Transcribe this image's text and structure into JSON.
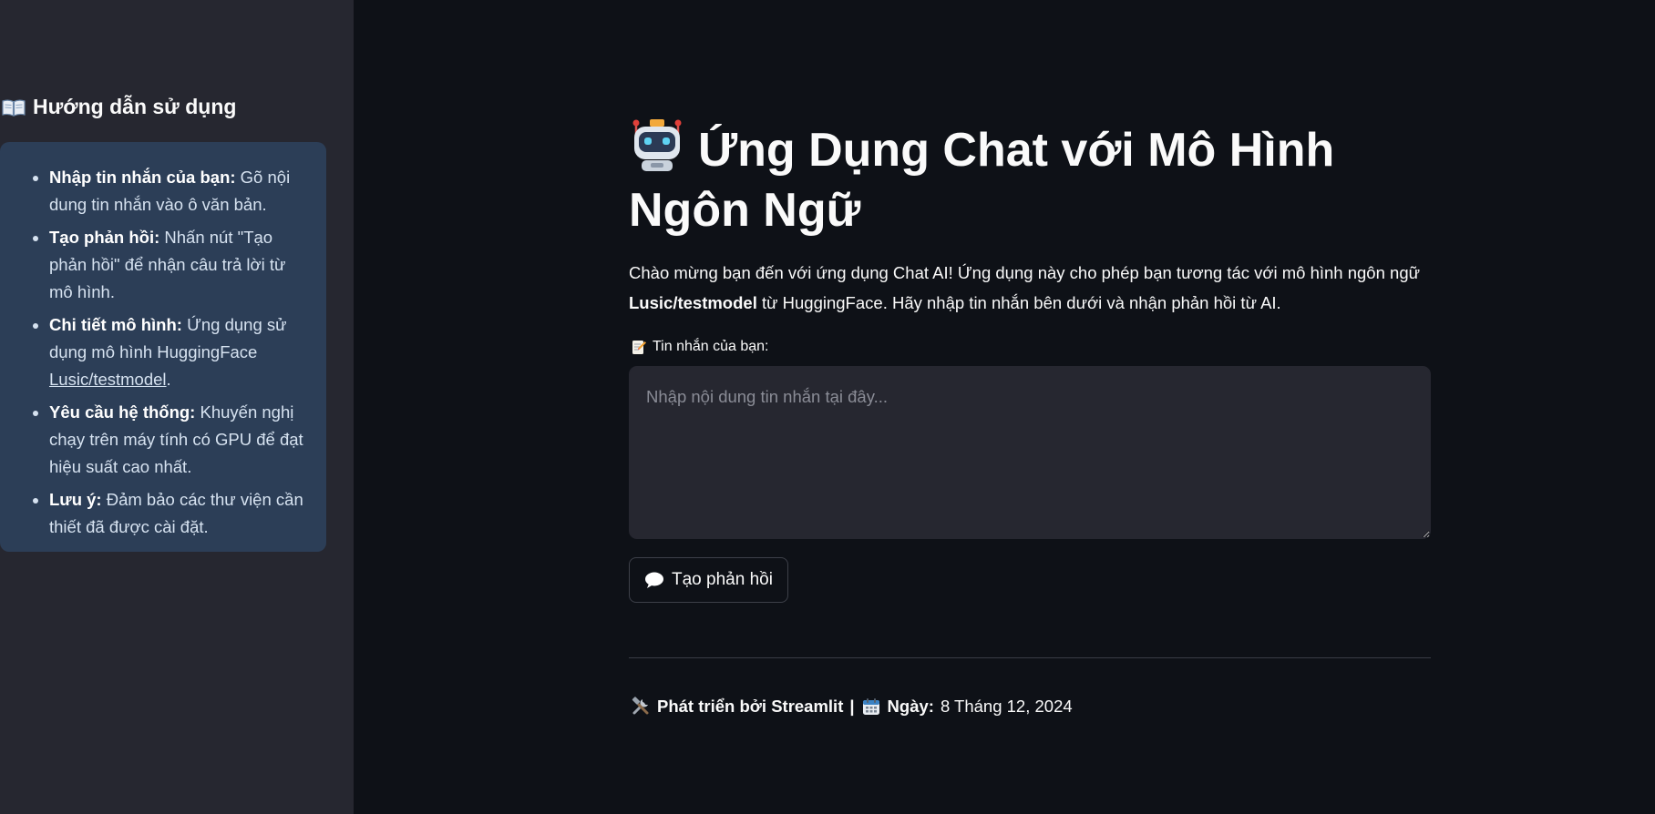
{
  "sidebar": {
    "title": "Hướng dẫn sử dụng",
    "title_icon": "book-icon",
    "items": [
      {
        "label": "Nhập tin nhắn của bạn:",
        "text": " Gõ nội dung tin nhắn vào ô văn bản."
      },
      {
        "label": "Tạo phản hồi:",
        "text": " Nhấn nút \"Tạo phản hồi\" để nhận câu trả lời từ mô hình."
      },
      {
        "label": "Chi tiết mô hình:",
        "text": " Ứng dụng sử dụng mô hình HuggingFace ",
        "link": "Lusic/testmodel",
        "suffix": "."
      },
      {
        "label": "Yêu cầu hệ thống:",
        "text": " Khuyến nghị chạy trên máy tính có GPU để đạt hiệu suất cao nhất."
      },
      {
        "label": "Lưu ý:",
        "text": " Đảm bảo các thư viện cần thiết đã được cài đặt."
      }
    ]
  },
  "main": {
    "title": "Ứng Dụng Chat với Mô Hình Ngôn Ngữ",
    "title_icon": "robot-icon",
    "intro_prefix": "Chào mừng bạn đến với ứng dụng Chat AI! Ứng dụng này cho phép bạn tương tác với mô hình ngôn ngữ ",
    "intro_model": "Lusic/testmodel",
    "intro_suffix": " từ HuggingFace. Hãy nhập tin nhắn bên dưới và nhận phản hồi từ AI.",
    "input_label": "Tin nhắn của bạn:",
    "input_label_icon": "memo-icon",
    "input_placeholder": "Nhập nội dung tin nhắn tại đây...",
    "input_value": "",
    "button_label": "Tạo phản hồi",
    "button_icon": "speech-balloon-icon",
    "footer": {
      "dev_label": "Phát triển bởi Streamlit",
      "separator": "|",
      "date_label": "Ngày:",
      "date_value": "8 Tháng 12, 2024"
    }
  },
  "colors": {
    "background": "#0e1117",
    "sidebar": "#262730",
    "info_box": "#2c3e57",
    "input_bg": "#262730",
    "text": "#fafafa"
  }
}
